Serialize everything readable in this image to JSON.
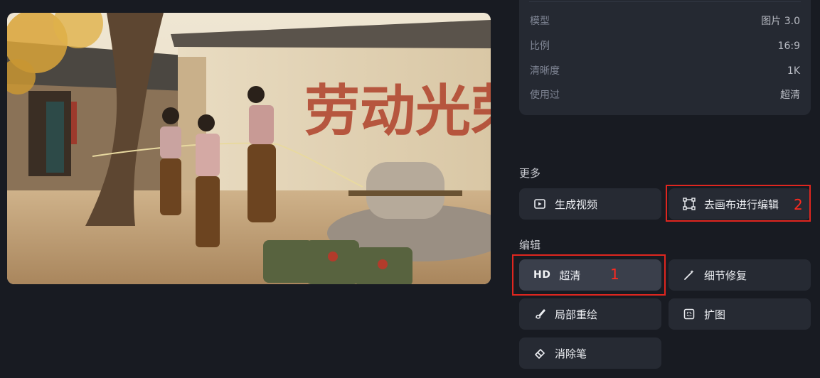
{
  "image": {
    "wall_slogan": "劳动光荣",
    "description_icon": "generated-photo"
  },
  "info": {
    "rows": [
      {
        "label": "模型",
        "value": "图片 3.0"
      },
      {
        "label": "比例",
        "value": "16:9"
      },
      {
        "label": "清晰度",
        "value": "1K"
      },
      {
        "label": "使用过",
        "value": "超清"
      }
    ]
  },
  "more": {
    "section_label": "更多",
    "generate_video": "生成视频",
    "canvas_edit": "去画布进行编辑"
  },
  "edit": {
    "section_label": "编辑",
    "hd_badge": "HD",
    "upscale": "超清",
    "detail_repair": "细节修复",
    "partial_redraw": "局部重绘",
    "expand": "扩图",
    "eraser": "消除笔"
  },
  "annotations": {
    "marker_1": "1",
    "marker_2": "2",
    "highlight_color": "#e0261f"
  }
}
